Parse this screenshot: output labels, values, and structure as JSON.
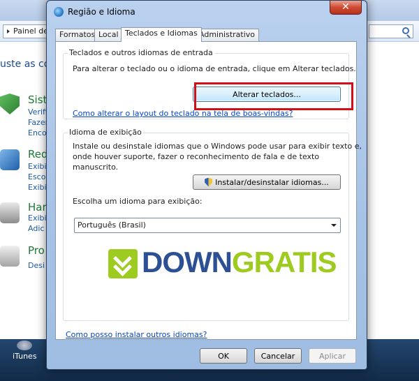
{
  "background": {
    "address": "Painel de",
    "heading": "uste as co",
    "categories": [
      {
        "title": "Sist",
        "links": [
          "Verifi",
          "Fazer",
          "Enco"
        ],
        "icon": "shield-icon",
        "color": "#3a8f3a"
      },
      {
        "title": "Red",
        "links": [
          "Exibi",
          "Esco",
          "Exibi"
        ],
        "icon": "network-icon",
        "color": "#2a6db8"
      },
      {
        "title": "Har",
        "links": [
          "Exibi",
          "Adic"
        ],
        "icon": "printer-icon",
        "color": "#7a7a7a"
      },
      {
        "title": "Pro",
        "links": [
          "Desi"
        ],
        "icon": "programs-icon",
        "color": "#9a9a9a"
      }
    ],
    "taskbar_item": "iTunes"
  },
  "dialog": {
    "title": "Região e Idioma",
    "tabs": [
      {
        "label": "Formatos",
        "active": false
      },
      {
        "label": "Local",
        "active": false
      },
      {
        "label": "Teclados e Idiomas",
        "active": true
      },
      {
        "label": "Administrativo",
        "active": false
      }
    ],
    "keyboards_group": {
      "title": "Teclados e outros idiomas de entrada",
      "description": "Para alterar o teclado ou o idioma de entrada, clique em Alterar teclados.",
      "button": "Alterar teclados...",
      "link": "Como alterar o layout do teclado na tela de boas-vindas?"
    },
    "display_group": {
      "title": "Idioma de exibição",
      "description_lines": [
        "Instale ou desinstale idiomas que o Windows pode usar para exibir texto e,",
        "onde houver suporte, fazer o reconhecimento de fala e de texto",
        "manuscrito."
      ],
      "install_button": "Instalar/desinstalar idiomas...",
      "choose_label": "Escolha um idioma para exibição:",
      "selected_language": "Português (Brasil)"
    },
    "bottom_link": "Como posso instalar outros idiomas?",
    "buttons": {
      "ok": "OK",
      "cancel": "Cancelar",
      "apply": "Aplicar"
    }
  },
  "watermark": {
    "part1": "DOWN",
    "part2": "GRATIS"
  },
  "colors": {
    "highlight": "#d10f1a",
    "link": "#0645c8",
    "watermark_green": "#9ecb1f",
    "watermark_blue": "#2d4f93"
  }
}
